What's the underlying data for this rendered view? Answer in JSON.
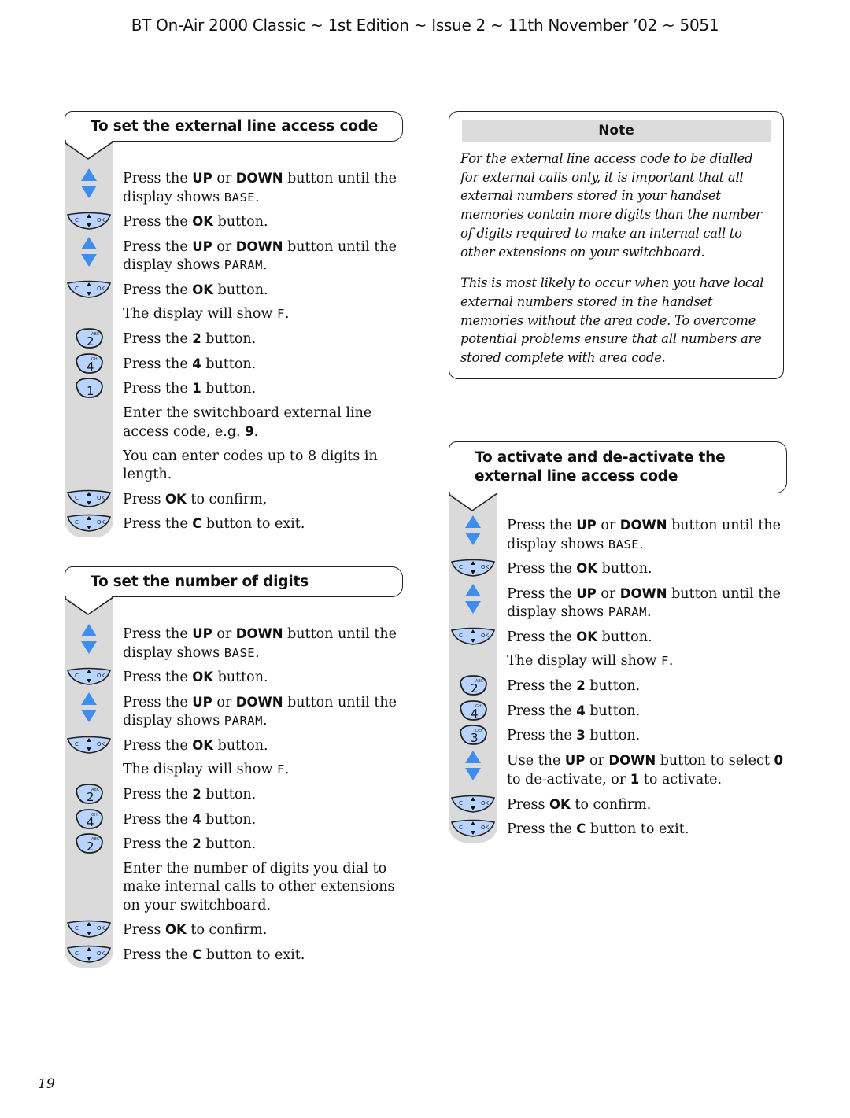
{
  "header": "BT On-Air 2000 Classic ~ 1st Edition ~ Issue 2 ~ 11th November ’02 ~ 5051",
  "page_number": "19",
  "colors": {
    "accent_blue": "#3d8ef0",
    "key_fill": "#b8d4ff",
    "rail_grey": "#dadada"
  },
  "section1": {
    "title": "To set the external line access code",
    "steps": [
      {
        "icon": "up-down-icon",
        "parts": [
          [
            "t",
            "Press the "
          ],
          [
            "b",
            "UP"
          ],
          [
            "t",
            " or "
          ],
          [
            "b",
            "DOWN"
          ],
          [
            "t",
            " button until the display shows "
          ],
          [
            "m",
            "BASE"
          ],
          [
            "t",
            "."
          ]
        ]
      },
      {
        "icon": "ok-nav-key-icon",
        "parts": [
          [
            "t",
            "Press the "
          ],
          [
            "b",
            "OK"
          ],
          [
            "t",
            " button."
          ]
        ]
      },
      {
        "icon": "up-down-icon",
        "parts": [
          [
            "t",
            "Press the "
          ],
          [
            "b",
            "UP"
          ],
          [
            "t",
            " or "
          ],
          [
            "b",
            "DOWN"
          ],
          [
            "t",
            " button until the display shows "
          ],
          [
            "m",
            "PARAM"
          ],
          [
            "t",
            "."
          ]
        ]
      },
      {
        "icon": "ok-nav-key-icon",
        "parts": [
          [
            "t",
            "Press the "
          ],
          [
            "b",
            "OK"
          ],
          [
            "t",
            " button."
          ]
        ]
      },
      {
        "icon": "",
        "parts": [
          [
            "t",
            "The display will show "
          ],
          [
            "m",
            "F"
          ],
          [
            "t",
            "."
          ]
        ]
      },
      {
        "icon": "key-2-icon",
        "key": "2",
        "sub": "ABC",
        "parts": [
          [
            "t",
            "Press the "
          ],
          [
            "b",
            "2"
          ],
          [
            "t",
            " button."
          ]
        ]
      },
      {
        "icon": "key-4-icon",
        "key": "4",
        "sub": "GHI",
        "parts": [
          [
            "t",
            "Press the "
          ],
          [
            "b",
            "4"
          ],
          [
            "t",
            " button."
          ]
        ]
      },
      {
        "icon": "key-1-icon",
        "key": "1",
        "sub": "",
        "parts": [
          [
            "t",
            "Press the "
          ],
          [
            "b",
            "1"
          ],
          [
            "t",
            " button."
          ]
        ]
      },
      {
        "icon": "",
        "parts": [
          [
            "t",
            "Enter the switchboard external line access code, e.g. "
          ],
          [
            "b",
            "9"
          ],
          [
            "t",
            "."
          ]
        ]
      },
      {
        "icon": "",
        "parts": [
          [
            "t",
            "You can enter codes up to 8 digits in length."
          ]
        ]
      },
      {
        "icon": "ok-nav-key-icon",
        "parts": [
          [
            "t",
            "Press "
          ],
          [
            "b",
            "OK"
          ],
          [
            "t",
            " to confirm,"
          ]
        ]
      },
      {
        "icon": "ok-nav-key-icon",
        "parts": [
          [
            "t",
            "Press the "
          ],
          [
            "b",
            "C"
          ],
          [
            "t",
            " button to exit."
          ]
        ]
      }
    ]
  },
  "section2": {
    "title": "To set the number of digits",
    "steps": [
      {
        "icon": "up-down-icon",
        "parts": [
          [
            "t",
            "Press the "
          ],
          [
            "b",
            "UP"
          ],
          [
            "t",
            " or "
          ],
          [
            "b",
            "DOWN"
          ],
          [
            "t",
            " button until the display shows "
          ],
          [
            "m",
            "BASE"
          ],
          [
            "t",
            "."
          ]
        ]
      },
      {
        "icon": "ok-nav-key-icon",
        "parts": [
          [
            "t",
            "Press the "
          ],
          [
            "b",
            "OK"
          ],
          [
            "t",
            " button."
          ]
        ]
      },
      {
        "icon": "up-down-icon",
        "parts": [
          [
            "t",
            "Press the "
          ],
          [
            "b",
            "UP"
          ],
          [
            "t",
            " or "
          ],
          [
            "b",
            "DOWN"
          ],
          [
            "t",
            " button until the display shows "
          ],
          [
            "m",
            "PARAM"
          ],
          [
            "t",
            "."
          ]
        ]
      },
      {
        "icon": "ok-nav-key-icon",
        "parts": [
          [
            "t",
            "Press the "
          ],
          [
            "b",
            "OK"
          ],
          [
            "t",
            " button."
          ]
        ]
      },
      {
        "icon": "",
        "parts": [
          [
            "t",
            "The display will show "
          ],
          [
            "m",
            "F"
          ],
          [
            "t",
            "."
          ]
        ]
      },
      {
        "icon": "key-2-icon",
        "key": "2",
        "sub": "ABC",
        "parts": [
          [
            "t",
            "Press the "
          ],
          [
            "b",
            "2"
          ],
          [
            "t",
            " button."
          ]
        ]
      },
      {
        "icon": "key-4-icon",
        "key": "4",
        "sub": "GHI",
        "parts": [
          [
            "t",
            "Press the "
          ],
          [
            "b",
            "4"
          ],
          [
            "t",
            " button."
          ]
        ]
      },
      {
        "icon": "key-2-icon",
        "key": "2",
        "sub": "ABC",
        "parts": [
          [
            "t",
            "Press the "
          ],
          [
            "b",
            "2"
          ],
          [
            "t",
            " button."
          ]
        ]
      },
      {
        "icon": "",
        "parts": [
          [
            "t",
            "Enter the number of digits you dial to make internal calls to other extensions on your switchboard."
          ]
        ]
      },
      {
        "icon": "ok-nav-key-icon",
        "parts": [
          [
            "t",
            "Press "
          ],
          [
            "b",
            "OK"
          ],
          [
            "t",
            " to confirm."
          ]
        ]
      },
      {
        "icon": "ok-nav-key-icon",
        "parts": [
          [
            "t",
            "Press the "
          ],
          [
            "b",
            "C"
          ],
          [
            "t",
            " button to exit."
          ]
        ]
      }
    ]
  },
  "note": {
    "title": "Note",
    "paragraphs": [
      "For the external line access code to be dialled for external calls only, it is important that all external numbers stored in your handset memories contain more digits than the number of digits required to make an internal call to other extensions on your switchboard.",
      "This is most likely to occur when you have local external numbers stored in the handset memories without the area code. To overcome potential problems ensure that all numbers are stored complete with area code."
    ]
  },
  "section3": {
    "title": "To activate and de-activate the external line access code",
    "steps": [
      {
        "icon": "up-down-icon",
        "parts": [
          [
            "t",
            "Press the "
          ],
          [
            "b",
            "UP"
          ],
          [
            "t",
            " or "
          ],
          [
            "b",
            "DOWN"
          ],
          [
            "t",
            " button until the display shows "
          ],
          [
            "m",
            "BASE"
          ],
          [
            "t",
            "."
          ]
        ]
      },
      {
        "icon": "ok-nav-key-icon",
        "parts": [
          [
            "t",
            "Press the "
          ],
          [
            "b",
            "OK"
          ],
          [
            "t",
            " button."
          ]
        ]
      },
      {
        "icon": "up-down-icon",
        "parts": [
          [
            "t",
            "Press the "
          ],
          [
            "b",
            "UP"
          ],
          [
            "t",
            " or "
          ],
          [
            "b",
            "DOWN"
          ],
          [
            "t",
            " button until the display shows "
          ],
          [
            "m",
            "PARAM"
          ],
          [
            "t",
            "."
          ]
        ]
      },
      {
        "icon": "ok-nav-key-icon",
        "parts": [
          [
            "t",
            "Press the "
          ],
          [
            "b",
            "OK"
          ],
          [
            "t",
            " button."
          ]
        ]
      },
      {
        "icon": "",
        "parts": [
          [
            "t",
            "The display will show "
          ],
          [
            "m",
            "F"
          ],
          [
            "t",
            "."
          ]
        ]
      },
      {
        "icon": "key-2-icon",
        "key": "2",
        "sub": "ABC",
        "parts": [
          [
            "t",
            "Press the "
          ],
          [
            "b",
            "2"
          ],
          [
            "t",
            " button."
          ]
        ]
      },
      {
        "icon": "key-4-icon",
        "key": "4",
        "sub": "GHI",
        "parts": [
          [
            "t",
            "Press the "
          ],
          [
            "b",
            "4"
          ],
          [
            "t",
            " button."
          ]
        ]
      },
      {
        "icon": "key-3-icon",
        "key": "3",
        "sub": "DEF",
        "parts": [
          [
            "t",
            "Press the "
          ],
          [
            "b",
            "3"
          ],
          [
            "t",
            " button."
          ]
        ]
      },
      {
        "icon": "up-down-icon",
        "parts": [
          [
            "t",
            "Use the "
          ],
          [
            "b",
            "UP"
          ],
          [
            "t",
            " or "
          ],
          [
            "b",
            "DOWN"
          ],
          [
            "t",
            " button to select "
          ],
          [
            "b",
            "0"
          ],
          [
            "t",
            " to de-activate, or "
          ],
          [
            "b",
            "1"
          ],
          [
            "t",
            " to activate."
          ]
        ]
      },
      {
        "icon": "ok-nav-key-icon",
        "parts": [
          [
            "t",
            "Press "
          ],
          [
            "b",
            "OK"
          ],
          [
            "t",
            " to confirm."
          ]
        ]
      },
      {
        "icon": "ok-nav-key-icon",
        "parts": [
          [
            "t",
            "Press the "
          ],
          [
            "b",
            "C"
          ],
          [
            "t",
            " button to exit."
          ]
        ]
      }
    ]
  }
}
